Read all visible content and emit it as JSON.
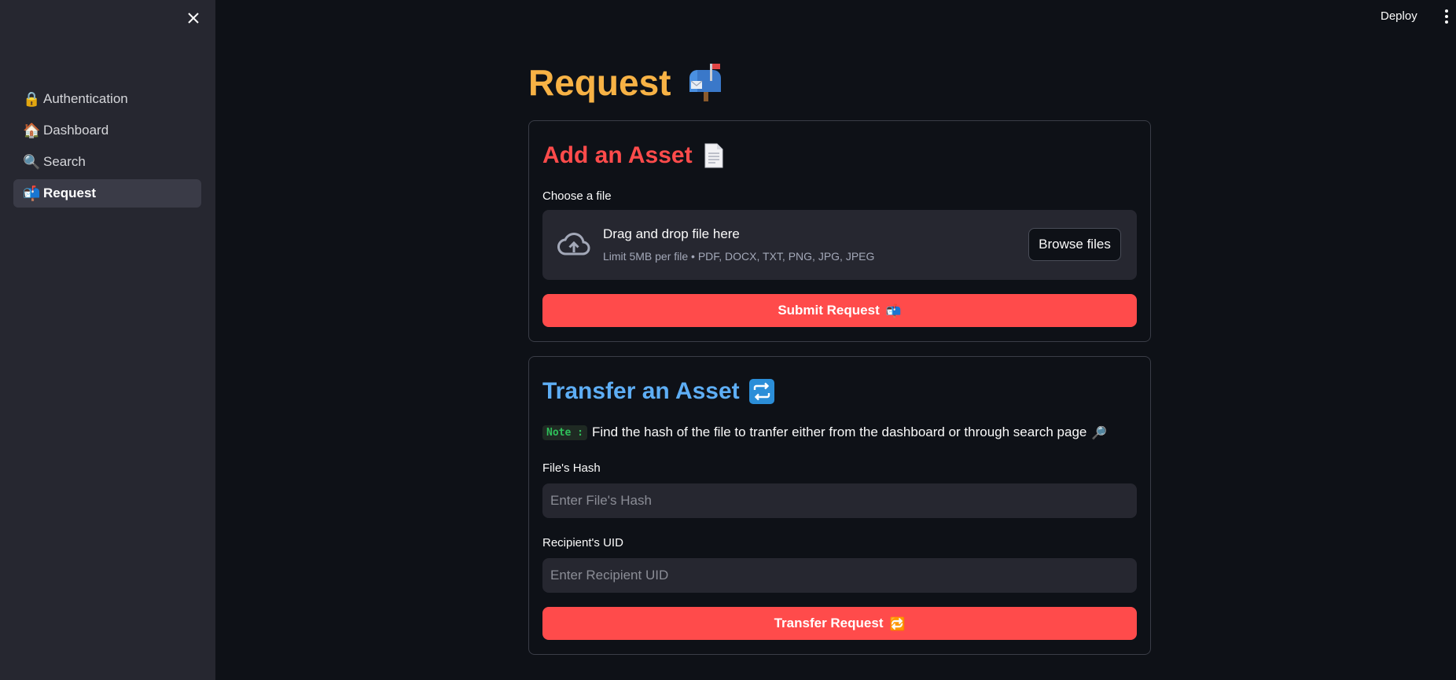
{
  "sidebar": {
    "items": [
      {
        "emoji": "🔒",
        "label": "Authentication"
      },
      {
        "emoji": "🏠",
        "label": "Dashboard"
      },
      {
        "emoji": "🔍",
        "label": "Search"
      },
      {
        "emoji": "📬",
        "label": "Request"
      }
    ],
    "active_index": 3
  },
  "topbar": {
    "deploy_label": "Deploy"
  },
  "page": {
    "title": "Request",
    "title_icon": "mailbox-icon"
  },
  "add_asset": {
    "heading": "Add an Asset",
    "heading_icon": "document-icon",
    "file_label": "Choose a file",
    "dropzone_title": "Drag and drop file here",
    "dropzone_limits": "Limit 5MB per file • PDF, DOCX, TXT, PNG, JPG, JPEG",
    "browse_label": "Browse files",
    "submit_label": "Submit Request",
    "submit_emoji": "📬"
  },
  "transfer_asset": {
    "heading": "Transfer an Asset",
    "heading_icon": "repeat-icon",
    "note_tag": "Note :",
    "note_text": "Find the hash of the file to tranfer either from the dashboard or through search page",
    "note_emoji": "🔎",
    "hash_label": "File's Hash",
    "hash_placeholder": "Enter File's Hash",
    "uid_label": "Recipient's UID",
    "uid_placeholder": "Enter Recipient UID",
    "transfer_label": "Transfer Request",
    "transfer_emoji": "🔁"
  },
  "colors": {
    "background": "#0e1117",
    "sidebar": "#262730",
    "title": "#f7b245",
    "add_heading": "#ff4b4b",
    "transfer_heading": "#5eaef5",
    "primary_button": "#ff4b4b",
    "note_code": "#2fbf5a"
  }
}
